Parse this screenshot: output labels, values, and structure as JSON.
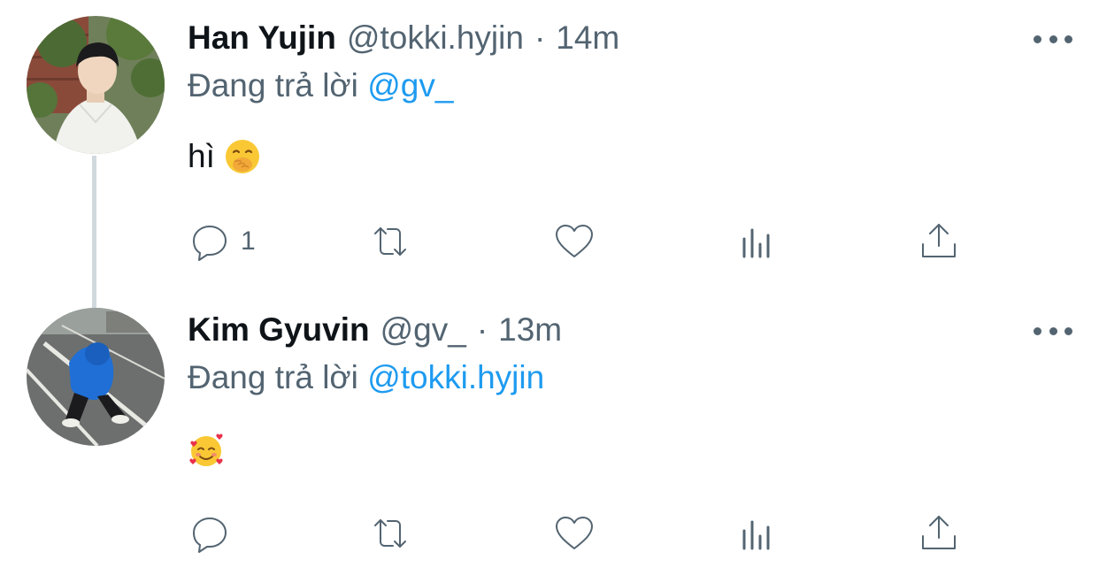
{
  "tweets": [
    {
      "display_name": "Han Yujin",
      "handle": "@tokki.hyjin",
      "separator": "·",
      "time": "14m",
      "reply_prefix": "Đang trả lời",
      "reply_mention": "@gv_",
      "text": "hì",
      "emoji": "face-with-hand-over-mouth",
      "reply_count": "1",
      "icons": [
        "comment-icon",
        "retweet-icon",
        "heart-icon",
        "views-icon",
        "share-icon",
        "more-icon"
      ]
    },
    {
      "display_name": "Kim Gyuvin",
      "handle": "@gv_",
      "separator": "·",
      "time": "13m",
      "reply_prefix": "Đang trả lời",
      "reply_mention": "@tokki.hyjin",
      "text": "",
      "emoji": "smiling-face-with-hearts",
      "reply_count": "",
      "icons": [
        "comment-icon",
        "retweet-icon",
        "heart-icon",
        "views-icon",
        "share-icon",
        "more-icon"
      ]
    }
  ],
  "colors": {
    "text_primary": "#0f1419",
    "text_secondary": "#536471",
    "mention": "#1d9bf0",
    "thread_line": "#cfd9de"
  }
}
